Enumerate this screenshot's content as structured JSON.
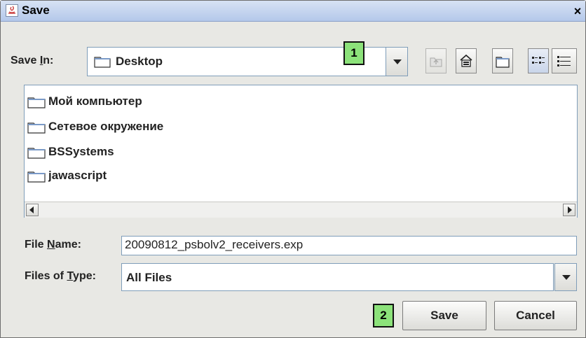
{
  "window": {
    "title": "Save",
    "close_symbol": "×"
  },
  "save_in": {
    "label_before": "Save ",
    "label_mnemonic": "I",
    "label_after": "n:",
    "value": "Desktop"
  },
  "toolbar": {
    "icons": [
      "up-one-level-icon",
      "home-icon",
      "new-folder-icon",
      "list-view-icon",
      "details-view-icon"
    ]
  },
  "markers": {
    "first": "1",
    "second": "2"
  },
  "file_list": {
    "items": [
      "Мой компьютер",
      "Сетевое окружение",
      "BSSystems",
      "jawascript"
    ]
  },
  "file_name": {
    "label_before": "File ",
    "label_mnemonic": "N",
    "label_after": "ame:",
    "value": "20090812_psbolv2_receivers.exp"
  },
  "file_type": {
    "label_before": "Files of ",
    "label_mnemonic": "T",
    "label_after": "ype:",
    "value": "All Files"
  },
  "buttons": {
    "save": "Save",
    "cancel": "Cancel"
  },
  "colors": {
    "marker": "#8ce27a",
    "title_bar": "#b4c8ea",
    "dialog_bg": "#e8e8e4"
  }
}
